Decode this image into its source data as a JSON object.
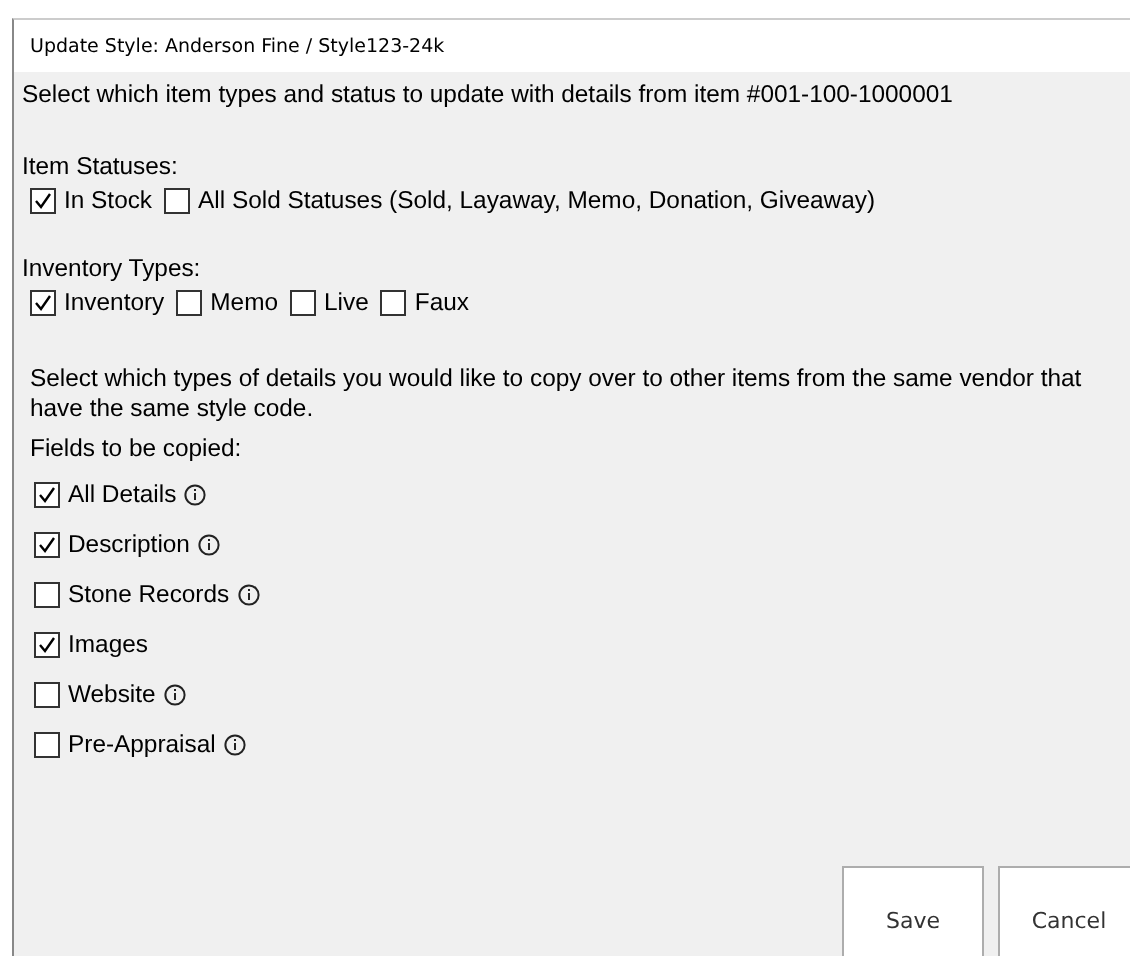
{
  "window": {
    "title": "Update Style: Anderson Fine / Style123-24k"
  },
  "intro": "Select which item types and status to update with details from item #001-100-1000001",
  "item_statuses": {
    "label": "Item Statuses:",
    "options": [
      {
        "label": "In Stock",
        "checked": true
      },
      {
        "label": "All Sold Statuses (Sold, Layaway, Memo, Donation, Giveaway)",
        "checked": false
      }
    ]
  },
  "inventory_types": {
    "label": "Inventory Types:",
    "options": [
      {
        "label": "Inventory",
        "checked": true
      },
      {
        "label": "Memo",
        "checked": false
      },
      {
        "label": "Live",
        "checked": false
      },
      {
        "label": "Faux",
        "checked": false
      }
    ]
  },
  "details_text": "Select which types of details you would like to copy over to other items from the same vendor that have the same style code.",
  "fields": {
    "label": "Fields to be copied:",
    "options": [
      {
        "label": "All Details",
        "checked": true,
        "info": true
      },
      {
        "label": "Description",
        "checked": true,
        "info": true
      },
      {
        "label": "Stone Records",
        "checked": false,
        "info": true
      },
      {
        "label": "Images",
        "checked": true,
        "info": false
      },
      {
        "label": "Website",
        "checked": false,
        "info": true
      },
      {
        "label": "Pre-Appraisal",
        "checked": false,
        "info": true
      }
    ]
  },
  "buttons": [
    "Save",
    "Cancel"
  ]
}
